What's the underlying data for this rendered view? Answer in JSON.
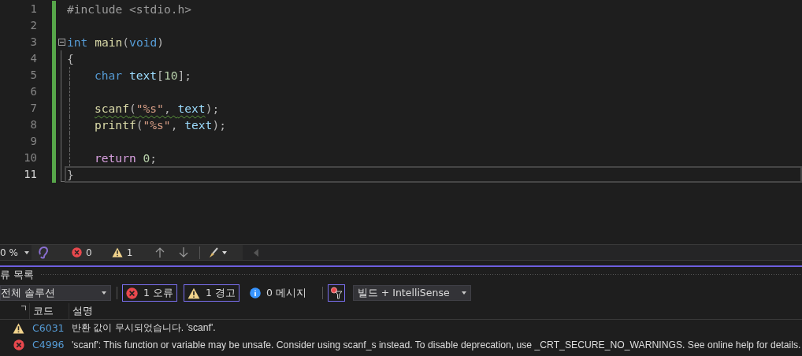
{
  "editor": {
    "lines": [
      {
        "number": "1",
        "current": false,
        "indented": false,
        "tokens": [
          {
            "text": "#include <stdio.h>",
            "kind": "preproc"
          }
        ]
      },
      {
        "number": "2",
        "current": false,
        "indented": false
      },
      {
        "number": "3",
        "current": false,
        "indented": false,
        "fold_expanded": true,
        "tokens": [
          {
            "text": "int",
            "kind": "keyword"
          },
          {
            "text": " main",
            "kind": "func"
          },
          {
            "text": "(",
            "kind": "punct"
          },
          {
            "text": "void",
            "kind": "keyword"
          },
          {
            "text": ")",
            "kind": "punct"
          }
        ]
      },
      {
        "number": "4",
        "current": false,
        "indented": false,
        "tokens": [
          {
            "text": "{",
            "kind": "punct"
          }
        ]
      },
      {
        "number": "5",
        "current": false,
        "indented": true,
        "tokens": [
          {
            "text": "char",
            "kind": "keyword"
          },
          {
            "text": " text",
            "kind": "var"
          },
          {
            "text": "[",
            "kind": "punct"
          },
          {
            "text": "10",
            "kind": "number"
          },
          {
            "text": "];",
            "kind": "punct"
          }
        ]
      },
      {
        "number": "6",
        "current": false,
        "indented": true
      },
      {
        "number": "7",
        "current": false,
        "indented": true,
        "tokens": [
          {
            "text": "scanf",
            "kind": "func",
            "squiggle": true
          },
          {
            "text": "(",
            "kind": "punct",
            "squiggle": true
          },
          {
            "text": "\"%s\"",
            "kind": "string",
            "squiggle": true
          },
          {
            "text": ", ",
            "kind": "punct",
            "squiggle": true
          },
          {
            "text": "text",
            "kind": "var",
            "squiggle": true
          },
          {
            "text": ");",
            "kind": "punct",
            "squiggle": false
          }
        ]
      },
      {
        "number": "8",
        "current": false,
        "indented": true,
        "tokens": [
          {
            "text": "printf",
            "kind": "func"
          },
          {
            "text": "(",
            "kind": "punct"
          },
          {
            "text": "\"%s\"",
            "kind": "string"
          },
          {
            "text": ", ",
            "kind": "punct"
          },
          {
            "text": "text",
            "kind": "var"
          },
          {
            "text": ");",
            "kind": "punct"
          }
        ]
      },
      {
        "number": "9",
        "current": false,
        "indented": true
      },
      {
        "number": "10",
        "current": false,
        "indented": true,
        "tokens": [
          {
            "text": "return",
            "kind": "control"
          },
          {
            "text": " 0",
            "kind": "number"
          },
          {
            "text": ";",
            "kind": "punct"
          }
        ]
      },
      {
        "number": "11",
        "current": true,
        "indented": false,
        "tokens": [
          {
            "text": "}",
            "kind": "punct"
          }
        ]
      }
    ]
  },
  "status_bar": {
    "zoom": "0 %",
    "errors": "0",
    "warnings": "1"
  },
  "error_list": {
    "title": "류 목록",
    "scope": "전체 솔루션",
    "filters": [
      {
        "kind": "error",
        "label": "1 오류",
        "selected": true
      },
      {
        "kind": "warning",
        "label": "1 경고",
        "selected": true
      },
      {
        "kind": "info",
        "label": "0 메시지",
        "selected": false
      }
    ],
    "filter_toggle": {
      "selected": true
    },
    "source": "빌드 + IntelliSense",
    "columns": [
      "코드",
      "설명"
    ],
    "rows": [
      {
        "kind": "warning",
        "code": "C6031",
        "description": "반환 값이 무시되었습니다. 'scanf'."
      },
      {
        "kind": "error",
        "code": "C4996",
        "description": "'scanf': This function or variable may be unsafe. Consider using scanf_s instead. To disable deprecation, use _CRT_SECURE_NO_WARNINGS. See online help for details."
      }
    ]
  }
}
